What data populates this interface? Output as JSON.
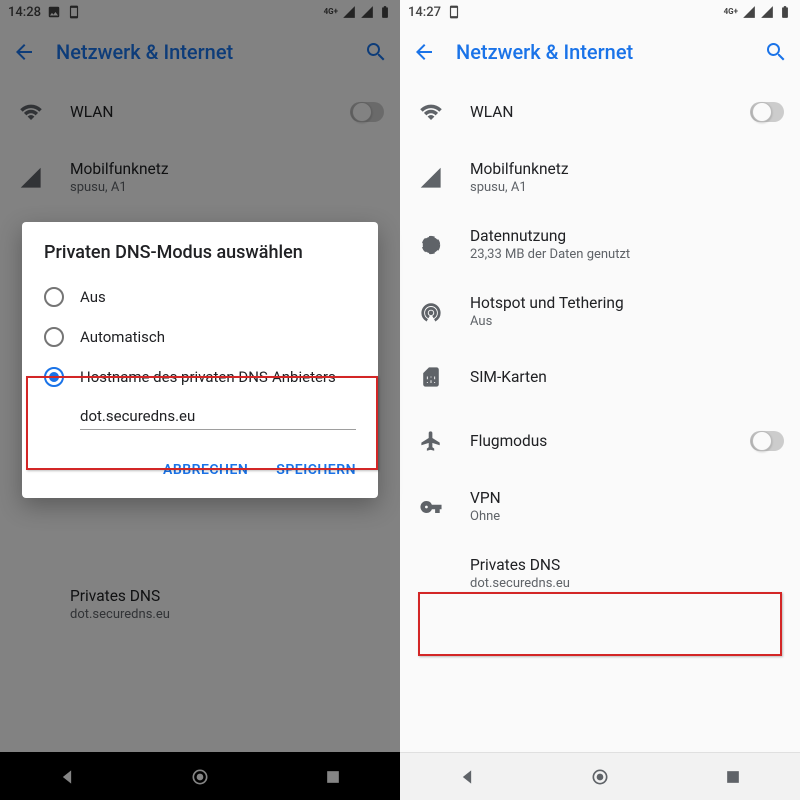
{
  "left": {
    "statusbar": {
      "time": "14:28",
      "net": "4G+"
    },
    "appbar": {
      "title": "Netzwerk & Internet"
    },
    "rows": {
      "wlan": {
        "title": "WLAN"
      },
      "mobile": {
        "title": "Mobilfunknetz",
        "sub": "spusu, A1"
      },
      "private_dns": {
        "title": "Privates DNS",
        "sub": "dot.securedns.eu"
      }
    },
    "dialog": {
      "title": "Privaten DNS-Modus auswählen",
      "opt_off": "Aus",
      "opt_auto": "Automatisch",
      "opt_host": "Hostname des privaten DNS-Anbieters",
      "hostname": "dot.securedns.eu",
      "cancel": "ABBRECHEN",
      "save": "SPEICHERN"
    }
  },
  "right": {
    "statusbar": {
      "time": "14:27",
      "net": "4G+"
    },
    "appbar": {
      "title": "Netzwerk & Internet"
    },
    "rows": {
      "wlan": {
        "title": "WLAN"
      },
      "mobile": {
        "title": "Mobilfunknetz",
        "sub": "spusu, A1"
      },
      "data": {
        "title": "Datennutzung",
        "sub": "23,33 MB der Daten genutzt"
      },
      "hotspot": {
        "title": "Hotspot und Tethering",
        "sub": "Aus"
      },
      "sim": {
        "title": "SIM-Karten"
      },
      "airplane": {
        "title": "Flugmodus"
      },
      "vpn": {
        "title": "VPN",
        "sub": "Ohne"
      },
      "private_dns": {
        "title": "Privates DNS",
        "sub": "dot.securedns.eu"
      }
    }
  }
}
